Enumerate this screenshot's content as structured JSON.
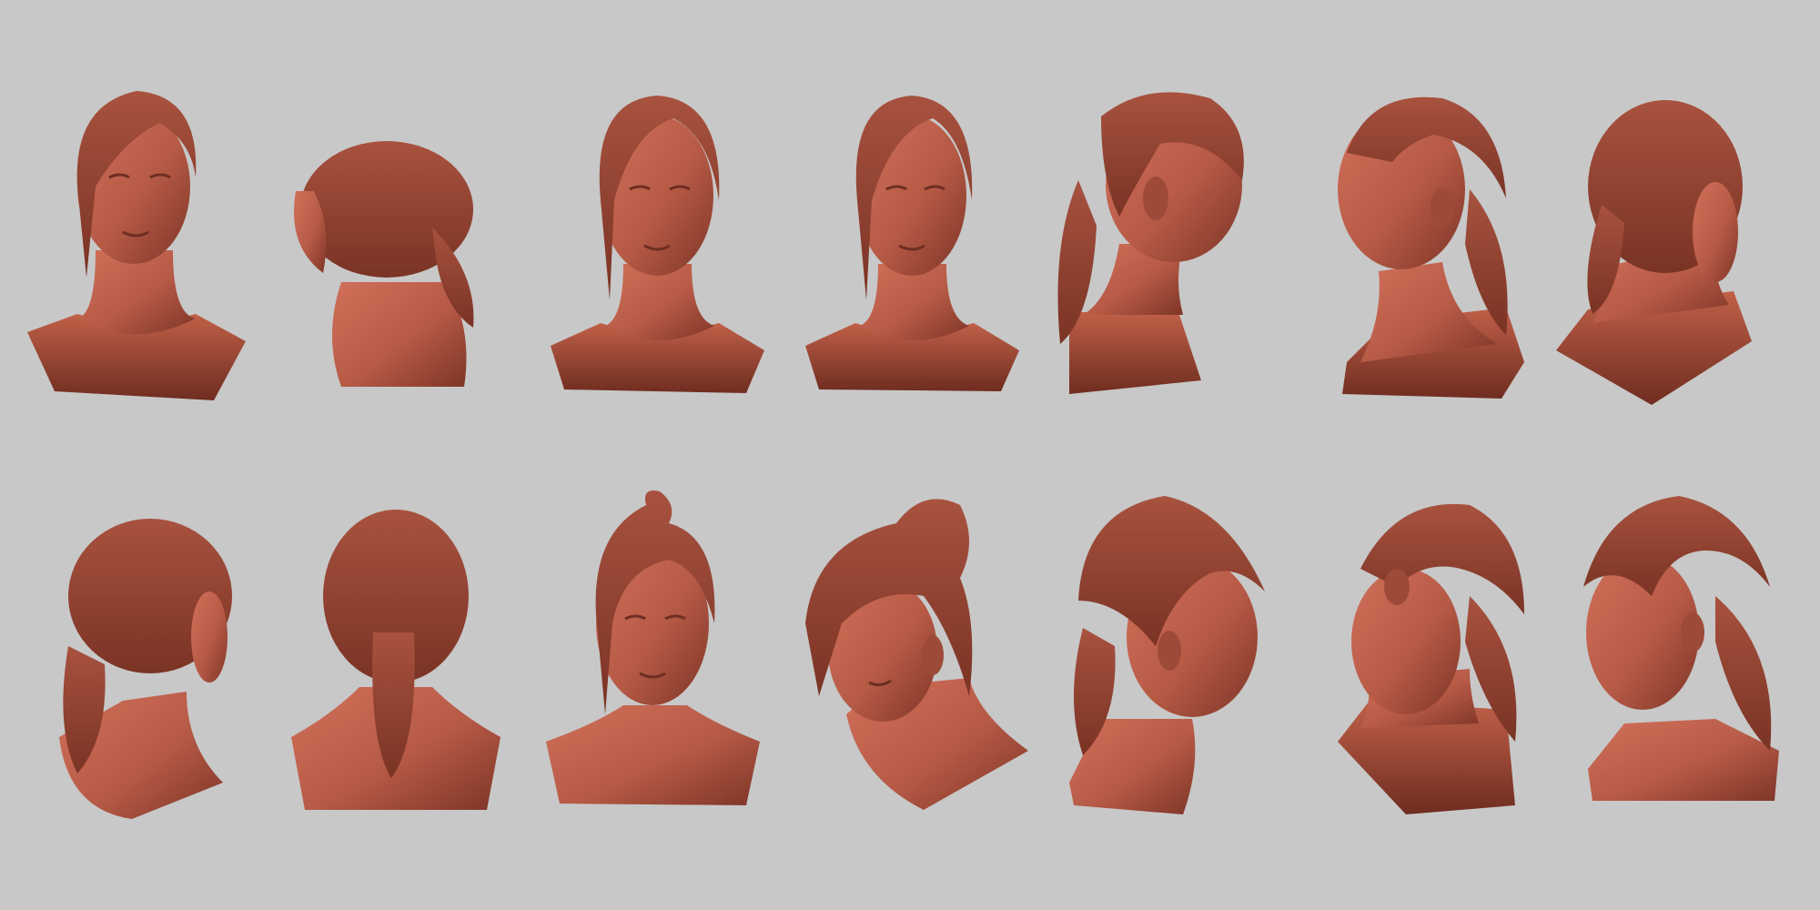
{
  "scene": {
    "background_color": "#c8c8c8",
    "clay_color": "#b65a46",
    "rows": [
      {
        "row_name": "top-row",
        "busts": [
          {
            "view": "front-left-tilt"
          },
          {
            "view": "back-left-three-quarter"
          },
          {
            "view": "front"
          },
          {
            "view": "front"
          },
          {
            "view": "right-profile"
          },
          {
            "view": "left-three-quarter-turned"
          },
          {
            "view": "back-right-three-quarter"
          }
        ]
      },
      {
        "row_name": "bottom-row",
        "busts": [
          {
            "view": "back-right-three-quarter"
          },
          {
            "view": "back"
          },
          {
            "view": "front-high"
          },
          {
            "view": "left-three-quarter-down"
          },
          {
            "view": "right-three-quarter-back"
          },
          {
            "view": "left-profile-back"
          },
          {
            "view": "left-three-quarter"
          }
        ]
      }
    ]
  }
}
